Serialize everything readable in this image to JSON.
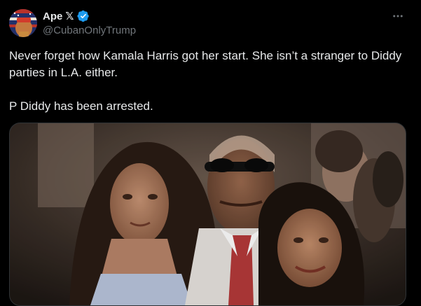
{
  "author": {
    "display_name": "Ape",
    "badge_glyph": "𝕏",
    "handle": "@CubanOnlyTrump",
    "verified": true,
    "verified_color": "#1d9bf0"
  },
  "tweet": {
    "paragraphs": [
      "Never forget how Kamala Harris got her start. She isn’t a stranger to Diddy parties in L.A. either.",
      "P Diddy has been arrested."
    ]
  },
  "icons": {
    "more": "more-horizontal-icon",
    "verified": "verified-badge-icon"
  },
  "colors": {
    "background": "#000000",
    "text_primary": "#e7e9ea",
    "text_secondary": "#71767b",
    "border": "#2f3336"
  }
}
